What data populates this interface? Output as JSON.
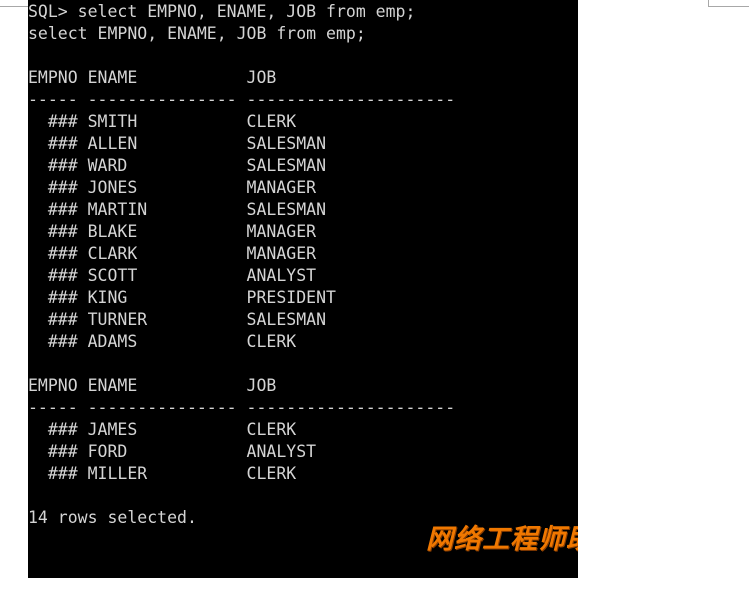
{
  "window": {
    "background_color": "#ffffff",
    "frame_line_color": "#a8a8a8"
  },
  "terminal": {
    "background_color": "#000000",
    "foreground_color": "#d4d4d4",
    "prompt": "SQL>",
    "command": "select EMPNO, ENAME, JOB from emp;",
    "echoed_command": "select EMPNO, ENAME, JOB from emp;",
    "columns": [
      "EMPNO",
      "ENAME",
      "JOB"
    ],
    "separator": "----- --------------- ---------------------",
    "header_line": "EMPNO ENAME           JOB",
    "empno_display": "###",
    "page1_rows": [
      {
        "empno": "###",
        "ename": "SMITH",
        "job": "CLERK"
      },
      {
        "empno": "###",
        "ename": "ALLEN",
        "job": "SALESMAN"
      },
      {
        "empno": "###",
        "ename": "WARD",
        "job": "SALESMAN"
      },
      {
        "empno": "###",
        "ename": "JONES",
        "job": "MANAGER"
      },
      {
        "empno": "###",
        "ename": "MARTIN",
        "job": "SALESMAN"
      },
      {
        "empno": "###",
        "ename": "BLAKE",
        "job": "MANAGER"
      },
      {
        "empno": "###",
        "ename": "CLARK",
        "job": "MANAGER"
      },
      {
        "empno": "###",
        "ename": "SCOTT",
        "job": "ANALYST"
      },
      {
        "empno": "###",
        "ename": "KING",
        "job": "PRESIDENT"
      },
      {
        "empno": "###",
        "ename": "TURNER",
        "job": "SALESMAN"
      },
      {
        "empno": "###",
        "ename": "ADAMS",
        "job": "CLERK"
      }
    ],
    "page2_rows": [
      {
        "empno": "###",
        "ename": "JAMES",
        "job": "CLERK"
      },
      {
        "empno": "###",
        "ename": "FORD",
        "job": "ANALYST"
      },
      {
        "empno": "###",
        "ename": "MILLER",
        "job": "CLERK"
      }
    ],
    "footer": "14 rows selected.",
    "row_count": 14,
    "screen_text": "SQL> select EMPNO, ENAME, JOB from emp;\nselect EMPNO, ENAME, JOB from emp;\n\nEMPNO ENAME           JOB\n----- --------------- ---------------------\n  ### SMITH           CLERK\n  ### ALLEN           SALESMAN\n  ### WARD            SALESMAN\n  ### JONES           MANAGER\n  ### MARTIN          SALESMAN\n  ### BLAKE           MANAGER\n  ### CLARK           MANAGER\n  ### SCOTT           ANALYST\n  ### KING            PRESIDENT\n  ### TURNER          SALESMAN\n  ### ADAMS           CLERK\n\nEMPNO ENAME           JOB\n----- --------------- ---------------------\n  ### JAMES           CLERK\n  ### FORD            ANALYST\n  ### MILLER          CLERK\n\n14 rows selected."
  },
  "watermark": {
    "text": "网络工程师助手",
    "color": "#f07800"
  }
}
